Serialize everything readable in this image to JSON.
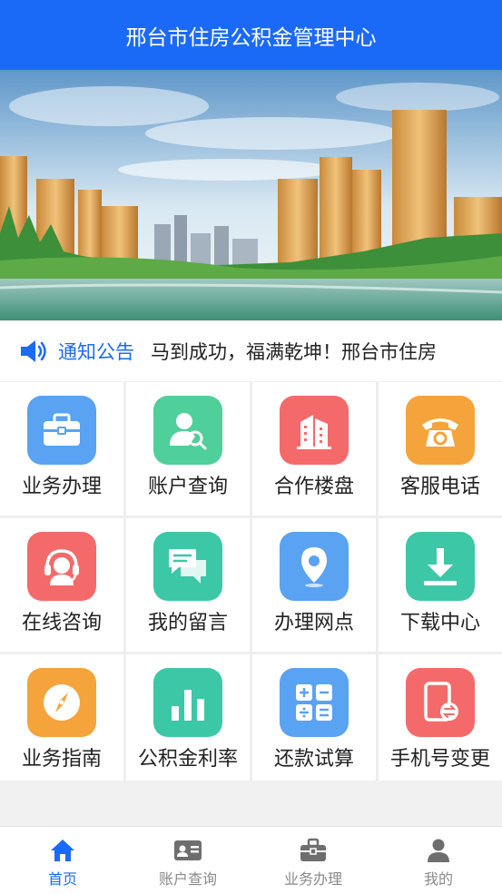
{
  "header": {
    "title": "邢台市住房公积金管理中心"
  },
  "banner": {
    "alt": "city-banner"
  },
  "notice": {
    "label": "通知公告",
    "text": "马到成功，福满乾坤！邢台市住房"
  },
  "grid": {
    "items": [
      {
        "label": "业务办理",
        "icon": "briefcase-icon",
        "color": "#5aa2f2"
      },
      {
        "label": "账户查询",
        "icon": "user-search-icon",
        "color": "#4fcf9a"
      },
      {
        "label": "合作楼盘",
        "icon": "building-icon",
        "color": "#f46a6a"
      },
      {
        "label": "客服电话",
        "icon": "phone-icon",
        "color": "#f5a33b"
      },
      {
        "label": "在线咨询",
        "icon": "headset-icon",
        "color": "#f46a6a"
      },
      {
        "label": "我的留言",
        "icon": "chat-icon",
        "color": "#3cc7a6"
      },
      {
        "label": "办理网点",
        "icon": "location-pin-icon",
        "color": "#5aa2f2"
      },
      {
        "label": "下载中心",
        "icon": "download-icon",
        "color": "#3cc7a6"
      },
      {
        "label": "业务指南",
        "icon": "compass-icon",
        "color": "#f5a33b"
      },
      {
        "label": "公积金利率",
        "icon": "bar-chart-icon",
        "color": "#3cc7a6"
      },
      {
        "label": "还款试算",
        "icon": "calculator-icon",
        "color": "#5aa2f2"
      },
      {
        "label": "手机号变更",
        "icon": "phone-change-icon",
        "color": "#f46a6a"
      }
    ]
  },
  "tabbar": {
    "items": [
      {
        "label": "首页",
        "icon": "home-icon",
        "active": true
      },
      {
        "label": "账户查询",
        "icon": "id-card-icon",
        "active": false
      },
      {
        "label": "业务办理",
        "icon": "briefcase-icon",
        "active": false
      },
      {
        "label": "我的",
        "icon": "person-icon",
        "active": false
      }
    ]
  },
  "colors": {
    "primary": "#1b6af7",
    "inactive": "#8a8a8a"
  }
}
